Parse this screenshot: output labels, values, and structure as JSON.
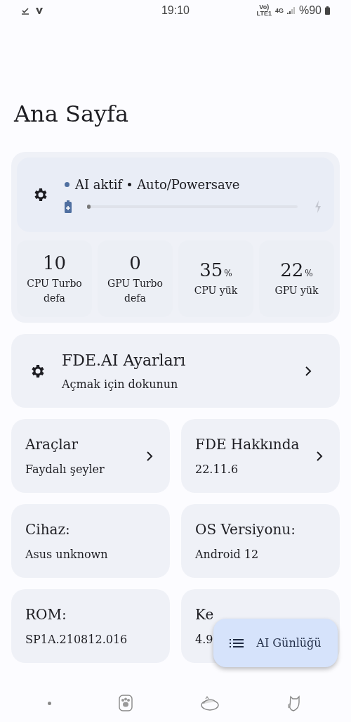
{
  "status_bar": {
    "time": "19:10",
    "volte": "Vo)",
    "lte": "LTE1",
    "network": "4G",
    "battery": "%90"
  },
  "title": "Ana Sayfa",
  "ai_card": {
    "status": "AI aktif",
    "mode": "Auto/Powersave",
    "slider": {
      "level": 0.0
    },
    "stats": [
      {
        "value": "10",
        "label": "CPU Turbo defa"
      },
      {
        "value": "0",
        "label": "GPU Turbo defa"
      },
      {
        "value": "35",
        "unit": "%",
        "label": "CPU yük"
      },
      {
        "value": "22",
        "unit": "%",
        "label": "GPU yük"
      }
    ]
  },
  "settings_card": {
    "title": "FDE.AI Ayarları",
    "subtitle": "Açmak için dokunun"
  },
  "tiles": [
    {
      "title": "Araçlar",
      "subtitle": "Faydalı şeyler",
      "chevron": true
    },
    {
      "title": "FDE Hakkında",
      "subtitle": "22.11.6",
      "chevron": true
    },
    {
      "title": "Cihaz:",
      "subtitle": "Asus unknown"
    },
    {
      "title": "OS Versiyonu:",
      "subtitle": "Android 12"
    },
    {
      "title": "ROM:",
      "subtitle": "SP1A.210812.016"
    },
    {
      "title": "Ke",
      "subtitle": "4.9"
    }
  ],
  "fab": {
    "label": "AI Günlüğü"
  },
  "bottom_nav": [
    {
      "kind": "dot"
    },
    {
      "kind": "paw"
    },
    {
      "kind": "bowl"
    },
    {
      "kind": "cat"
    }
  ]
}
